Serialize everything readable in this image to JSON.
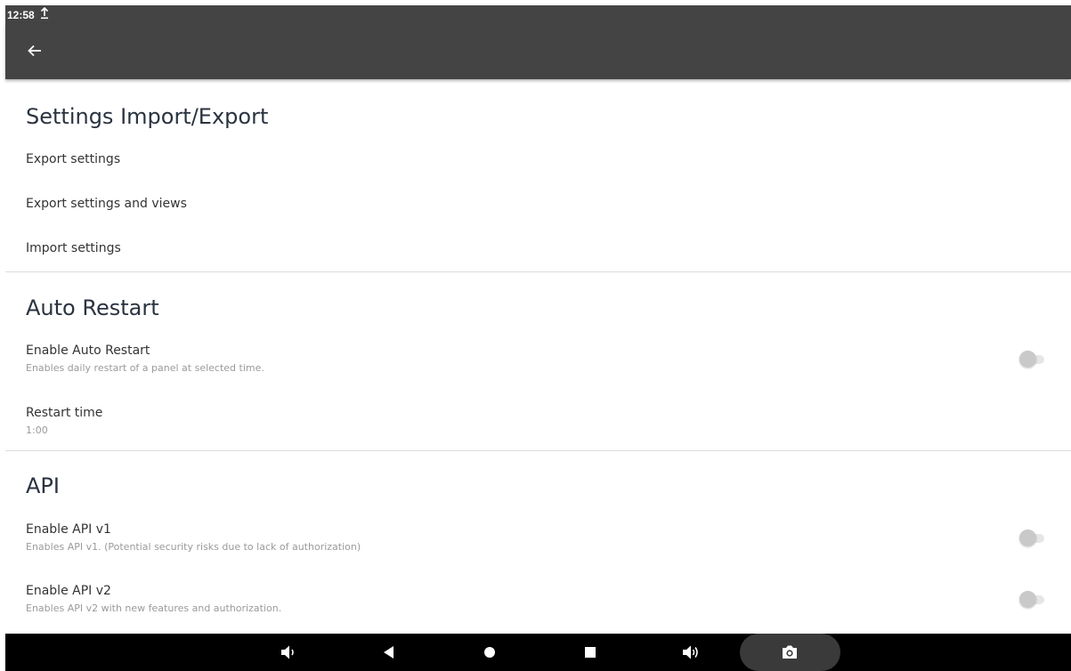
{
  "status_bar": {
    "time": "12:58",
    "upload_icon": "upload-icon"
  },
  "toolbar": {
    "back_icon": "arrow-back-icon"
  },
  "sections": {
    "import_export": {
      "title": "Settings Import/Export",
      "export_settings": "Export settings",
      "export_settings_views": "Export settings and views",
      "import_settings": "Import settings"
    },
    "auto_restart": {
      "title": "Auto Restart",
      "enable_title": "Enable Auto Restart",
      "enable_summary": "Enables daily restart of a panel at selected time.",
      "enable_on": false,
      "restart_time_title": "Restart time",
      "restart_time_value": "1:00"
    },
    "api": {
      "title": "API",
      "v1_title": "Enable API v1",
      "v1_summary": "Enables API v1. (Potential security risks due to lack of authorization)",
      "v1_on": false,
      "v2_title": "Enable API v2",
      "v2_summary": "Enables API v2 with new features and authorization.",
      "v2_on": false
    }
  },
  "nav_bar": {
    "icons": [
      "volume-down-icon",
      "back-triangle-icon",
      "home-circle-icon",
      "recents-square-icon",
      "volume-up-icon",
      "camera-icon"
    ]
  }
}
